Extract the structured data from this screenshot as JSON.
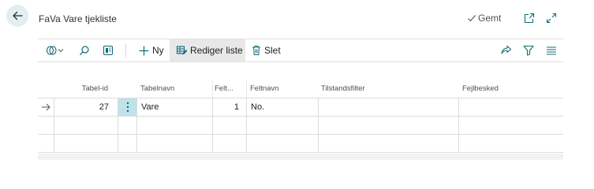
{
  "header": {
    "title": "FaVa Vare tjekliste",
    "saved_label": "Gemt",
    "icons": [
      "back-arrow-icon",
      "check-icon",
      "open-new-window-icon",
      "expand-icon"
    ]
  },
  "toolbar": {
    "new_label": "Ny",
    "edit_list_label": "Rediger liste",
    "delete_label": "Slet",
    "icons": [
      "filter-pane-icon",
      "search-icon",
      "view-layout-icon",
      "share-icon",
      "filter-icon",
      "list-view-icon"
    ]
  },
  "grid": {
    "columns": [
      "Tabel-id",
      "Tabelnavn",
      "Felt...",
      "Feltnavn",
      "Tilstandsfilter",
      "Fejlbesked"
    ],
    "rows": [
      {
        "tabel_id": "27",
        "tabelnavn": "Vare",
        "felt": "1",
        "feltnavn": "No.",
        "tilstandsfilter": "",
        "fejlbesked": ""
      },
      {
        "tabel_id": "",
        "tabelnavn": "",
        "felt": "",
        "feltnavn": "",
        "tilstandsfilter": "",
        "fejlbesked": ""
      },
      {
        "tabel_id": "",
        "tabelnavn": "",
        "felt": "",
        "feltnavn": "",
        "tilstandsfilter": "",
        "fejlbesked": ""
      }
    ]
  },
  "colors": {
    "accent": "#0f6c7a",
    "selected_cell_bg": "#bfe3e8",
    "back_button_bg": "#e3eef1"
  }
}
